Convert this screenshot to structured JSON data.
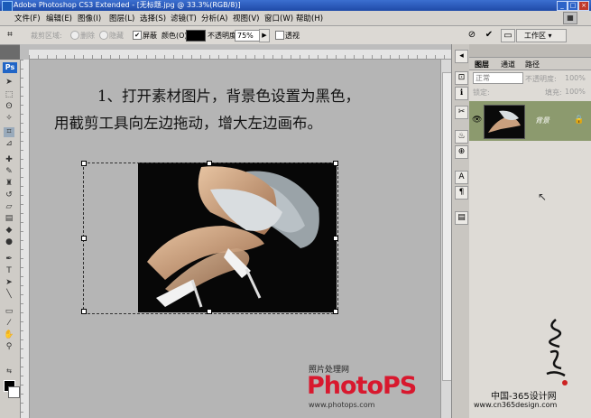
{
  "window": {
    "title": "Adobe Photoshop CS3 Extended - [无标题.jpg @ 33.3%(RGB/8)]",
    "controls": [
      "_",
      "□",
      "×"
    ]
  },
  "menu": {
    "items": [
      "文件(F)",
      "编辑(E)",
      "图像(I)",
      "图层(L)",
      "选择(S)",
      "滤镜(T)",
      "分析(A)",
      "视图(V)",
      "窗口(W)",
      "帮助(H)"
    ]
  },
  "options": {
    "crop_area_label": "裁剪区域:",
    "delete_label": "删除",
    "hide_label": "隐藏",
    "shield_label": "屏蔽",
    "color_label": "颜色(O):",
    "opacity_label": "不透明度:",
    "opacity_value": "75%",
    "perspective_label": "透视",
    "workspace_label": "工作区",
    "shield_checked": true,
    "perspective_checked": false
  },
  "toolbox": {
    "logo": "Ps"
  },
  "instruction": {
    "line1": "1、打开素材图片，背景色设置为黑色，",
    "line2": "用截剪工具向左边拖动，增大左边画布。"
  },
  "panel": {
    "tabs": [
      "图层",
      "通道",
      "路径"
    ],
    "blend_mode": "正常",
    "opacity_label": "不透明度:",
    "opacity_value": "100%",
    "lock_label": "锁定:",
    "fill_label": "填充:",
    "fill_value": "100%",
    "layer_name": "背景"
  },
  "watermark": {
    "top_text": "照片处理网",
    "brand": "PhotoPS",
    "url": "www.photops.com"
  },
  "footer": {
    "site_name": "中国-365设计网",
    "site_url": "www.cn365design.com"
  },
  "colors": {
    "titlebar": "#2a5cc0",
    "layer_selected": "#8c9a6e",
    "canvas_gray": "#b5b5b5"
  }
}
